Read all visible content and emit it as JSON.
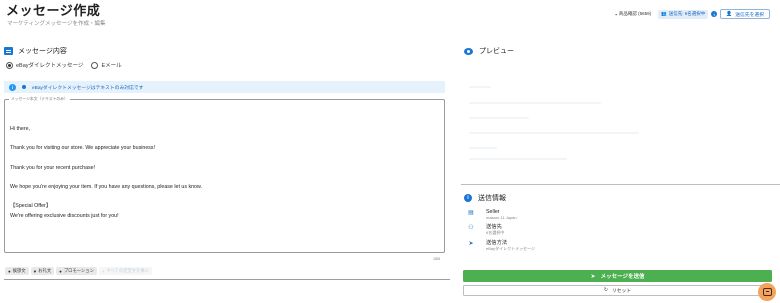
{
  "header": {
    "title": "メッセージ作成",
    "subtitle": "マーケティングメッセージを作成・編集",
    "stock_label": "商品確認 (5659)",
    "recipients_chip": "送信先: 6名選択中",
    "select_recipients_button": "送信先を選択"
  },
  "composer": {
    "section_title": "メッセージ内容",
    "channel_options": [
      {
        "label": "eBayダイレクトメッセージ",
        "selected": true
      },
      {
        "label": "Eメール",
        "selected": false
      }
    ],
    "notice": "eBayダイレクトメッセージはテキストのみ対応です",
    "textarea_label": "メッセージ本文（テキストのみ）",
    "body_lines": [
      "Hi there,",
      "",
      "Thank you for visiting our store. We appreciate your business!",
      "",
      "Thank you for your recent purchase!",
      "",
      "We hope you're enjoying your item. If you have any questions, please let us know.",
      "",
      "【Special Offer】",
      "We're offering exclusive discounts just for you!"
    ],
    "char_count": "283",
    "chips": [
      {
        "label": "挨拶文",
        "icon": "waving-hand-icon",
        "disabled": false
      },
      {
        "label": "お礼文",
        "icon": "heart-icon",
        "disabled": false
      },
      {
        "label": "プロモーション",
        "icon": "tag-icon",
        "disabled": false
      },
      {
        "label": "すべての定型文を挿入",
        "icon": "plus-icon",
        "disabled": true
      }
    ]
  },
  "preview": {
    "title": "プレビュー"
  },
  "send_info": {
    "title": "送信情報",
    "rows": [
      {
        "icon": "store-icon",
        "label": "Seller",
        "value": "masaru 11 Japan"
      },
      {
        "icon": "people-icon",
        "label": "送信先",
        "value": "6名選択中"
      },
      {
        "icon": "send-icon",
        "label": "送信方法",
        "value": "eBayダイレクトメッセージ"
      }
    ],
    "send_button": "メッセージを送信",
    "reset_button": "リセット"
  },
  "colors": {
    "primary": "#1976d2",
    "success": "#4caf50",
    "notice_bg": "#e5f2fb",
    "fab": "#f3a35d"
  }
}
